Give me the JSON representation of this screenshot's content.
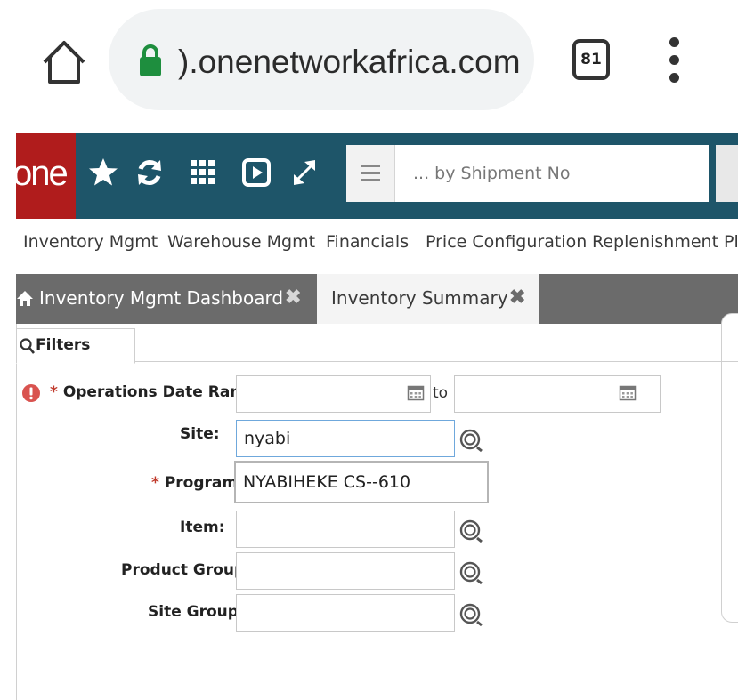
{
  "browser": {
    "url": ").onenetworkafrica.com",
    "tab_count": "81"
  },
  "app": {
    "logo_text": "one",
    "search_placeholder": "... by Shipment No",
    "colors": {
      "header": "#1e5569",
      "logo": "#b01c1c",
      "tabbar": "#6b6b6b",
      "required": "#c0392b"
    },
    "header_icons": [
      "star-icon",
      "refresh-icon",
      "grid-icon",
      "play-box-icon",
      "expand-icon",
      "hamburger-icon"
    ]
  },
  "module_nav": [
    "Inventory Mgmt",
    "Warehouse Mgmt",
    "Financials",
    "Price Configuration",
    "Replenishment Pla"
  ],
  "tabs": [
    {
      "label": "Inventory Mgmt Dashboard",
      "icon": "home-icon"
    },
    {
      "label": "Inventory Summary"
    }
  ],
  "filters": {
    "tab_label": "Filters",
    "operations_date_range": {
      "label": "Operations Date Range:",
      "from": "",
      "to_label": "to",
      "to": ""
    },
    "site": {
      "label": "Site:",
      "value": "nyabi"
    },
    "program": {
      "label": "Program:",
      "value": "NYABIHEKE CS--610"
    },
    "item": {
      "label": "Item:",
      "value": ""
    },
    "product_group": {
      "label": "Product Group:",
      "value": ""
    },
    "site_group": {
      "label": "Site Group:",
      "value": ""
    }
  }
}
